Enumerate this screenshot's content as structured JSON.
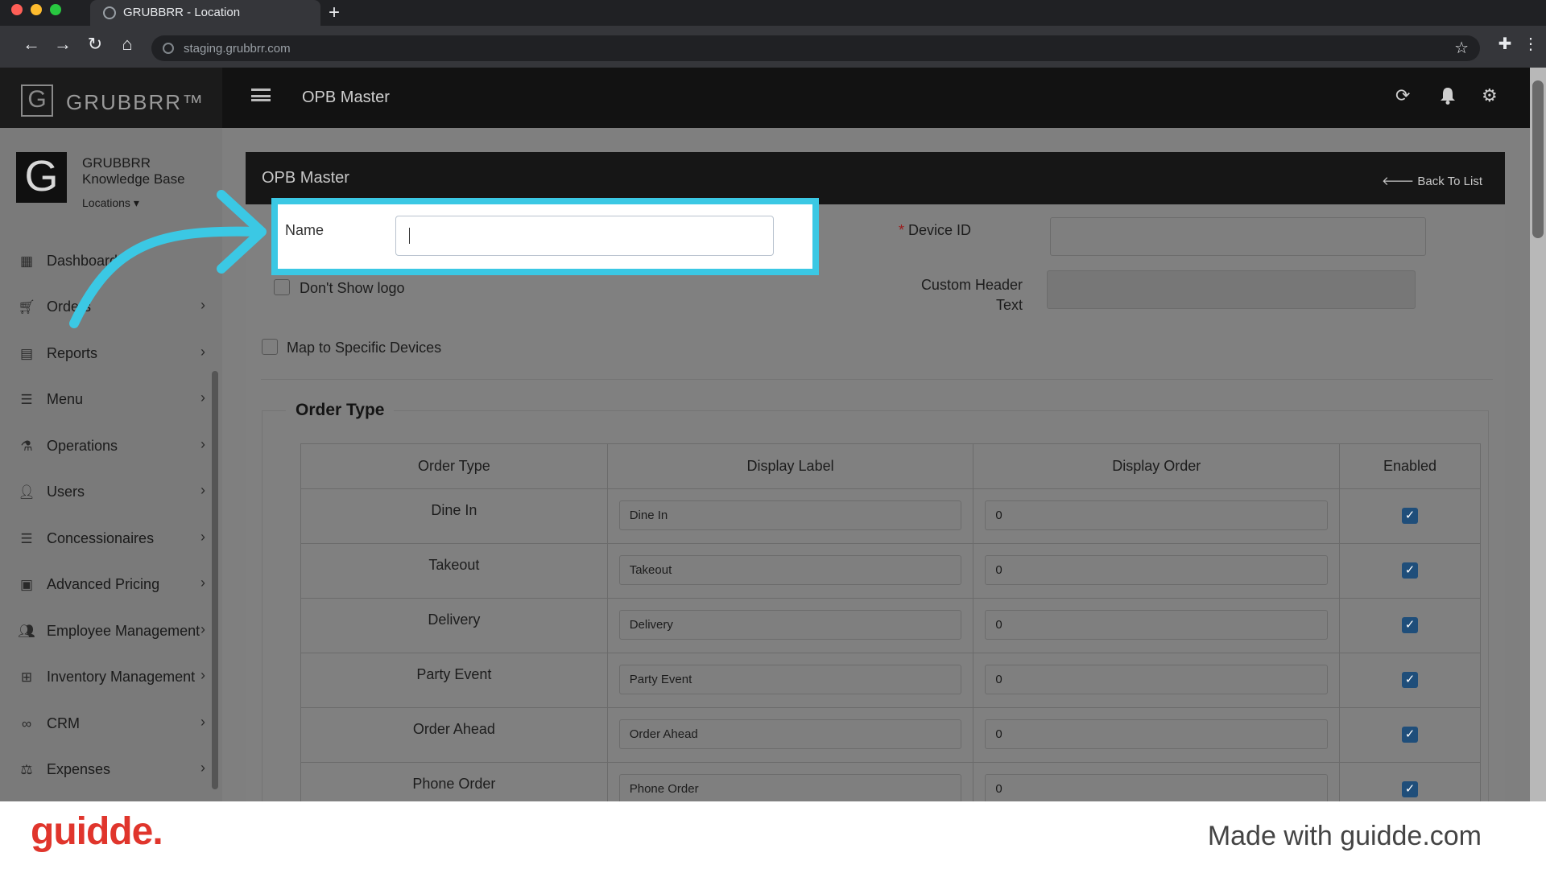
{
  "browser": {
    "tab_title": "GRUBBRR - Location",
    "new_tab": "+",
    "url": "staging.grubbrr.com"
  },
  "brand": {
    "logo_letter": "G",
    "name": "GRUBBRR™"
  },
  "header": {
    "title": "OPB Master"
  },
  "sidebar": {
    "avatar_letter": "G",
    "org_name": "GRUBBRR Knowledge Base",
    "locations_label": "Locations ▾",
    "items": [
      {
        "label": "Dashboard",
        "icon": "dashboard-icon"
      },
      {
        "label": "Orders",
        "icon": "cart-icon"
      },
      {
        "label": "Reports",
        "icon": "report-icon"
      },
      {
        "label": "Menu",
        "icon": "menu-list-icon"
      },
      {
        "label": "Operations",
        "icon": "flask-icon"
      },
      {
        "label": "Users",
        "icon": "user-add-icon"
      },
      {
        "label": "Concessionaires",
        "icon": "list-icon"
      },
      {
        "label": "Advanced Pricing",
        "icon": "money-icon"
      },
      {
        "label": "Employee Management",
        "icon": "users-icon"
      },
      {
        "label": "Inventory Management",
        "icon": "sitemap-icon"
      },
      {
        "label": "CRM",
        "icon": "link-icon"
      },
      {
        "label": "Expenses",
        "icon": "scale-icon"
      }
    ]
  },
  "panel": {
    "title": "OPB Master",
    "back_link": "Back To List"
  },
  "form": {
    "name_label": "Name",
    "name_value": "",
    "device_id_required": "*",
    "device_id_label": "Device ID",
    "custom_header_label_line1": "Custom Header",
    "custom_header_label_line2": "Text",
    "dont_show_logo_label": "Don't Show logo",
    "map_devices_label": "Map to Specific Devices"
  },
  "order_type": {
    "legend": "Order Type",
    "columns": [
      "Order Type",
      "Display Label",
      "Display Order",
      "Enabled"
    ],
    "rows": [
      {
        "type": "Dine In",
        "label": "Dine In",
        "order": "0",
        "enabled": true
      },
      {
        "type": "Takeout",
        "label": "Takeout",
        "order": "0",
        "enabled": true
      },
      {
        "type": "Delivery",
        "label": "Delivery",
        "order": "0",
        "enabled": true
      },
      {
        "type": "Party Event",
        "label": "Party Event",
        "order": "0",
        "enabled": true
      },
      {
        "type": "Order Ahead",
        "label": "Order Ahead",
        "order": "0",
        "enabled": true
      },
      {
        "type": "Phone Order",
        "label": "Phone Order",
        "order": "0",
        "enabled": true
      }
    ]
  },
  "footer": {
    "logo": "guidde.",
    "text": "Made with guidde.com"
  },
  "colors": {
    "highlight": "#3bc8e4",
    "footer_logo": "#e0352c",
    "checkbox": "#1f4e7a"
  }
}
